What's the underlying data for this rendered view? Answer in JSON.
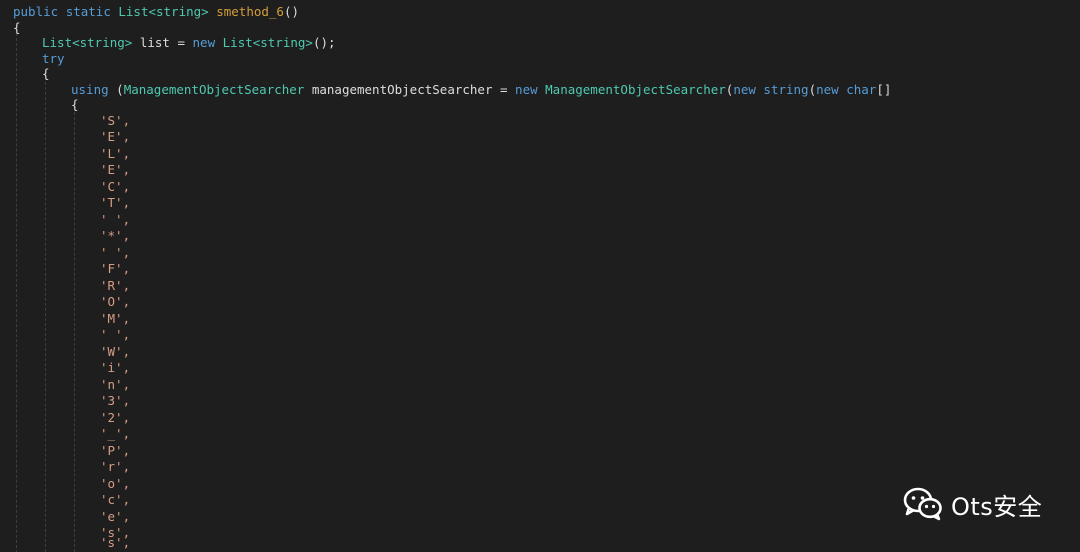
{
  "code": {
    "signature": {
      "public": "public",
      "static": "static",
      "type": "List<string>",
      "name": "smethod_6",
      "parens": "()"
    },
    "open_brace": "{",
    "list_decl": {
      "type1": "List<string>",
      "var": " list = ",
      "new": "new",
      "type2": "List<string>",
      "end": "();"
    },
    "try_keyword": "try",
    "try_brace": "{",
    "using_line": {
      "using": "using",
      "paren": " (",
      "type1": "ManagementObjectSearcher",
      "var": " managementObjectSearcher = ",
      "new1": "new",
      "type2": "ManagementObjectSearcher",
      "paren2": "(",
      "new2": "new",
      "string_kw": "string",
      "paren3": "(",
      "new3": "new",
      "char_kw": "char",
      "brackets": "[]"
    },
    "array_brace": "{",
    "chars": [
      "'S',",
      "'E',",
      "'L',",
      "'E',",
      "'C',",
      "'T',",
      "' ',",
      "'*',",
      "' ',",
      "'F',",
      "'R',",
      "'O',",
      "'M',",
      "' ',",
      "'W',",
      "'i',",
      "'n',",
      "'3',",
      "'2',",
      "'_',",
      "'P',",
      "'r',",
      "'o',",
      "'c',",
      "'e',",
      "'s',",
      "'s',"
    ]
  },
  "watermark": {
    "icon": "wechat-icon",
    "text": "Ots安全"
  },
  "colors": {
    "background": "#1e1e1e",
    "keyword": "#569cd6",
    "type": "#4ec9b0",
    "method": "#d69d3a",
    "char_literal": "#d69d85",
    "plain": "#dcdcdc"
  }
}
